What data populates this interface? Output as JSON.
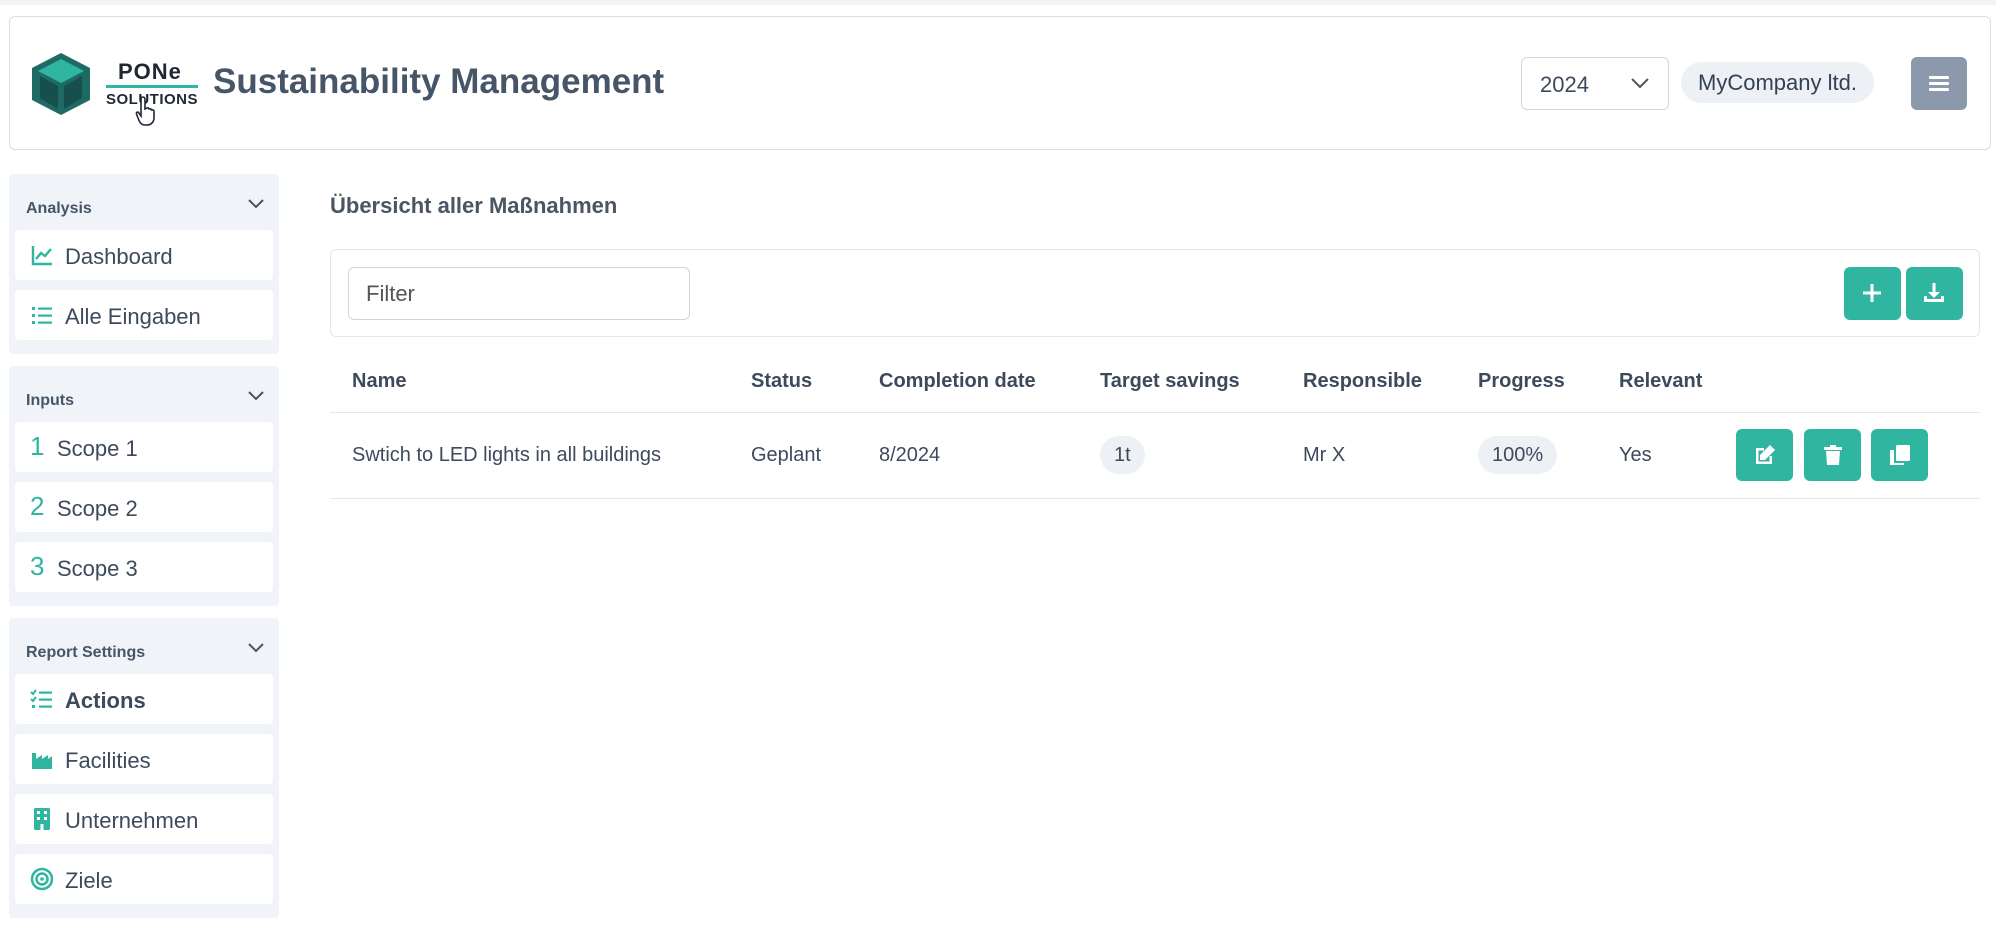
{
  "header": {
    "logo_text_top": "PONe",
    "logo_text_bottom": "SOLUTIONS",
    "title": "Sustainability Management",
    "year": "2024",
    "company": "MyCompany ltd."
  },
  "sidebar": {
    "groups": [
      {
        "label": "Analysis",
        "items": [
          {
            "label": "Dashboard"
          },
          {
            "label": "Alle Eingaben"
          }
        ]
      },
      {
        "label": "Inputs",
        "items": [
          {
            "num": "1",
            "label": "Scope 1"
          },
          {
            "num": "2",
            "label": "Scope 2"
          },
          {
            "num": "3",
            "label": "Scope 3"
          }
        ]
      },
      {
        "label": "Report Settings",
        "items": [
          {
            "label": "Actions"
          },
          {
            "label": "Facilities"
          },
          {
            "label": "Unternehmen"
          },
          {
            "label": "Ziele"
          }
        ]
      }
    ]
  },
  "main": {
    "title": "Übersicht aller Maßnahmen",
    "filter_placeholder": "Filter",
    "table": {
      "headers": [
        "Name",
        "Status",
        "Completion date",
        "Target savings",
        "Responsible",
        "Progress",
        "Relevant"
      ],
      "rows": [
        {
          "name": "Swtich to LED lights in all buildings",
          "status": "Geplant",
          "completion": "8/2024",
          "target": "1t",
          "responsible": "Mr X",
          "progress": "100%",
          "relevant": "Yes"
        }
      ]
    }
  },
  "colors": {
    "accent": "#2fb5a0",
    "menu_button": "#8c98ab",
    "sidebar_bg": "#f0f3f7"
  },
  "icons": [
    "chart-line-icon",
    "list-icon",
    "tasks-icon",
    "industry-icon",
    "building-icon",
    "target-icon",
    "plus-icon",
    "download-icon",
    "edit-icon",
    "trash-icon",
    "copy-icon",
    "chevron-down-icon",
    "hamburger-icon"
  ]
}
